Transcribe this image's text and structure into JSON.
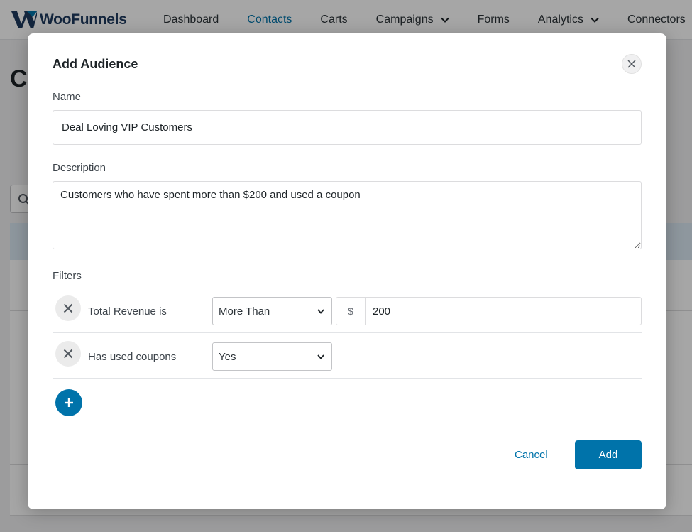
{
  "app": {
    "logo_text": "WooFunnels",
    "brand_color": "#0073aa"
  },
  "nav": {
    "items": [
      {
        "label": "Dashboard",
        "active": false,
        "dropdown": false
      },
      {
        "label": "Contacts",
        "active": true,
        "dropdown": false
      },
      {
        "label": "Carts",
        "active": false,
        "dropdown": false
      },
      {
        "label": "Campaigns",
        "active": false,
        "dropdown": true
      },
      {
        "label": "Forms",
        "active": false,
        "dropdown": false
      },
      {
        "label": "Analytics",
        "active": false,
        "dropdown": true
      },
      {
        "label": "Connectors",
        "active": false,
        "dropdown": false
      }
    ]
  },
  "background": {
    "page_title_fragment": "Co"
  },
  "modal": {
    "title": "Add Audience",
    "close_icon": "close-icon",
    "name_label": "Name",
    "name_value": "Deal Loving VIP Customers",
    "description_label": "Description",
    "description_value": "Customers who have spent more than $200 and used a coupon",
    "filters_label": "Filters",
    "filters": [
      {
        "label": "Total Revenue is",
        "operator": "More Than",
        "prefix": "$",
        "value": "200"
      },
      {
        "label": "Has used coupons",
        "operator": "Yes"
      }
    ],
    "cancel_label": "Cancel",
    "add_label": "Add"
  }
}
